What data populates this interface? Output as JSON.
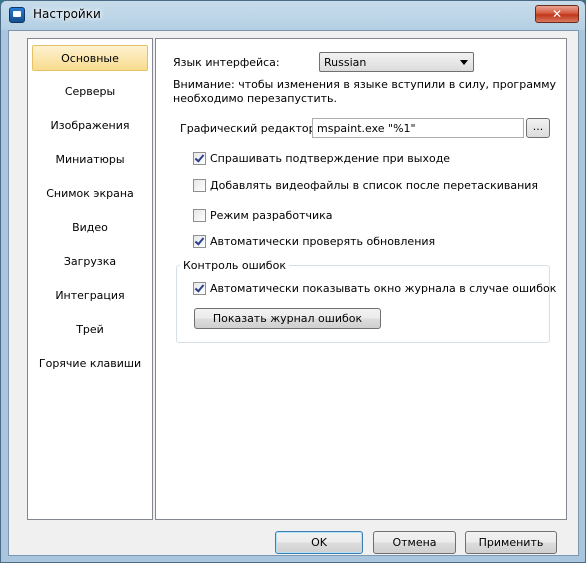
{
  "window": {
    "title": "Настройки",
    "close_label": "✕"
  },
  "nav": {
    "items": [
      {
        "label": "Основные",
        "active": true
      },
      {
        "label": "Серверы"
      },
      {
        "label": "Изображения"
      },
      {
        "label": "Миниатюры"
      },
      {
        "label": "Снимок экрана"
      },
      {
        "label": "Видео"
      },
      {
        "label": "Загрузка"
      },
      {
        "label": "Интеграция"
      },
      {
        "label": "Трей"
      },
      {
        "label": "Горячие клавиши"
      }
    ]
  },
  "general": {
    "language_label": "Язык интерфейса:",
    "language_value": "Russian",
    "language_notice_line1": "Внимание: чтобы изменения в языке вступили в силу, программу",
    "language_notice_line2": "необходимо перезапустить.",
    "editor_label": "Графический редактор:",
    "editor_value": "mspaint.exe \"%1\"",
    "browse_label": "...",
    "checkboxes": [
      {
        "label": "Спрашивать подтверждение при выходе",
        "checked": true
      },
      {
        "label": "Добавлять видеофайлы в список после перетаскивания",
        "checked": false
      },
      {
        "label": "Режим разработчика",
        "checked": false
      },
      {
        "label": "Автоматически проверять обновления",
        "checked": true
      }
    ],
    "error_group": {
      "title": "Контроль ошибок",
      "auto_show_log_label": "Автоматически показывать окно журнала в случае ошибок",
      "auto_show_log_checked": true,
      "show_log_button": "Показать журнал ошибок"
    }
  },
  "footer": {
    "ok": "OK",
    "cancel": "Отмена",
    "apply": "Применить"
  }
}
